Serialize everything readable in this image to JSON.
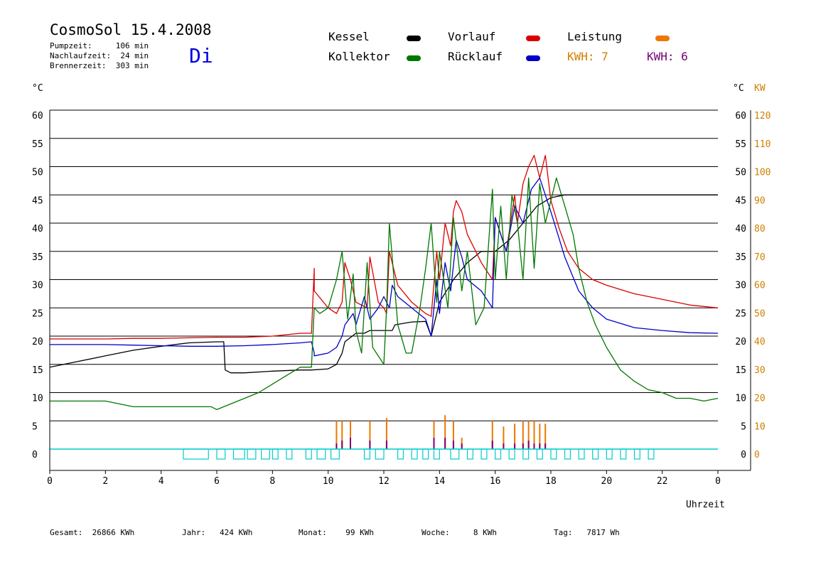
{
  "header": {
    "title": "CosmoSol 15.4.2008",
    "weekday": "Di",
    "pumpzeit": "Pumpzeit:     106 min",
    "nachlaufzeit": "Nachlaufzeit:  24 min",
    "brennerzeit": "Brennerzeit:  303 min"
  },
  "legend": {
    "kessel": "Kessel",
    "kollektor": "Kollektor",
    "vorlauf": "Vorlauf",
    "ruecklauf": "Rücklauf",
    "leistung": "Leistung",
    "kwh_orange": "KWH: 7",
    "kwh_purple": "KWH: 6"
  },
  "footer": {
    "gesamt": "Gesamt:  26866 KWh",
    "jahr": "Jahr:   424 KWh",
    "monat": "Monat:    99 KWh",
    "woche": "Woche:     8 KWh",
    "tag": "Tag:   7817 Wh"
  },
  "colors": {
    "kessel": "#000000",
    "kollektor": "#007700",
    "vorlauf": "#dd0000",
    "ruecklauf": "#0000cc",
    "leistung": "#ee7700",
    "kwh_purple": "#770077",
    "pump": "#00cccc",
    "axis_right_kw": "#d08000"
  },
  "chart_data": {
    "type": "line",
    "xlabel": "Uhrzeit",
    "ylabel_left": "°C",
    "ylabel_right": "°C",
    "ylabel_right2": "KW",
    "xlim": [
      0,
      24
    ],
    "ylim": [
      0,
      60
    ],
    "y2lim": [
      0,
      120
    ],
    "x_ticks": [
      "0",
      "2",
      "4",
      "6",
      "8",
      "10",
      "12",
      "14",
      "16",
      "18",
      "20",
      "22",
      "0"
    ],
    "y_ticks": [
      "0",
      "5",
      "10",
      "15",
      "20",
      "25",
      "30",
      "35",
      "40",
      "45",
      "50",
      "55",
      "60"
    ],
    "y2_ticks": [
      "0",
      "10",
      "20",
      "30",
      "40",
      "50",
      "60",
      "70",
      "80",
      "90",
      "100",
      "110",
      "120"
    ],
    "grid": true,
    "series": [
      {
        "name": "Kessel",
        "key": "kessel",
        "x": [
          0,
          1,
          2,
          3,
          4,
          5,
          6,
          6.25,
          6.3,
          6.5,
          7,
          8,
          9,
          9.4,
          10,
          10.3,
          10.5,
          10.6,
          11,
          11.3,
          11.5,
          12,
          12.3,
          12.4,
          13,
          13.5,
          13.7,
          14,
          14.5,
          15,
          15.5,
          16,
          16.5,
          17,
          17.5,
          18,
          18.5,
          20,
          22,
          24
        ],
        "y": [
          14.5,
          15.5,
          16.5,
          17.5,
          18.2,
          18.8,
          19,
          19,
          14,
          13.5,
          13.5,
          13.8,
          14,
          14,
          14.2,
          15,
          17,
          19,
          20.5,
          20.5,
          21,
          21,
          21,
          22,
          22.5,
          22.6,
          20,
          26,
          30,
          33,
          35,
          35,
          37,
          40,
          43,
          44.5,
          45,
          45,
          45,
          45
        ]
      },
      {
        "name": "Vorlauf",
        "key": "vorlauf",
        "x": [
          0,
          1,
          2,
          3,
          4,
          5,
          6,
          7,
          8,
          9,
          9.4,
          9.5,
          9.5,
          10,
          10.3,
          10.5,
          10.6,
          10.8,
          11,
          11.4,
          11.5,
          11.8,
          12,
          12.1,
          12.2,
          12.5,
          13,
          13.5,
          13.7,
          13.9,
          14,
          14.2,
          14.4,
          14.5,
          14.6,
          14.8,
          15,
          15.5,
          15.9,
          16,
          16.4,
          16.7,
          16.8,
          17,
          17.2,
          17.4,
          17.6,
          17.8,
          18,
          18.3,
          18.6,
          19,
          19.5,
          20,
          21,
          22,
          23,
          24
        ],
        "y": [
          19.5,
          19.5,
          19.5,
          19.6,
          19.6,
          19.7,
          19.8,
          19.8,
          20,
          20.5,
          20.5,
          32,
          28,
          25,
          24,
          26,
          33,
          30,
          26,
          25,
          34,
          26,
          25,
          24,
          35,
          29,
          26,
          24,
          23.5,
          35,
          30,
          40,
          36,
          42,
          44,
          42,
          38,
          33,
          30,
          41,
          35,
          45,
          40,
          47,
          50,
          52,
          48,
          52,
          44,
          39,
          35,
          32,
          30,
          29,
          27.5,
          26.5,
          25.5,
          25
        ]
      },
      {
        "name": "Rücklauf",
        "key": "ruecklauf",
        "x": [
          0,
          1,
          2,
          3,
          4,
          5,
          6,
          7,
          8,
          9,
          9.4,
          9.5,
          9.5,
          10,
          10.3,
          10.5,
          10.6,
          10.9,
          11,
          11.3,
          11.5,
          11.8,
          12,
          12.2,
          12.3,
          12.5,
          13,
          13.5,
          13.7,
          13.9,
          14,
          14.2,
          14.4,
          14.6,
          14.8,
          15,
          15.5,
          15.9,
          16,
          16.4,
          16.7,
          17,
          17.3,
          17.6,
          17.8,
          18,
          18.5,
          19,
          19.5,
          20,
          21,
          22,
          23,
          24
        ],
        "y": [
          18.5,
          18.5,
          18.5,
          18.4,
          18.3,
          18.2,
          18.2,
          18.3,
          18.5,
          18.8,
          19,
          17,
          16.5,
          17,
          18,
          20,
          22,
          24,
          22,
          27,
          23,
          25,
          27,
          25,
          29,
          27,
          25,
          23,
          20,
          30,
          24,
          33,
          28,
          37,
          34,
          30,
          28,
          25,
          41,
          35,
          43,
          40,
          46,
          48,
          45,
          42,
          34,
          28,
          25,
          23,
          21.5,
          21,
          20.6,
          20.5
        ]
      },
      {
        "name": "Kollektor",
        "key": "kollektor",
        "x": [
          0,
          0.5,
          1,
          2,
          3,
          4,
          5,
          5.8,
          6,
          6.5,
          7,
          7.5,
          8,
          8.5,
          9,
          9.4,
          9.5,
          9.7,
          10,
          10.3,
          10.5,
          10.7,
          10.9,
          11,
          11.2,
          11.4,
          11.6,
          12,
          12.1,
          12.2,
          12.5,
          12.8,
          13,
          13.3,
          13.5,
          13.7,
          13.9,
          14,
          14.3,
          14.5,
          14.8,
          15,
          15.3,
          15.6,
          15.9,
          16,
          16.2,
          16.4,
          16.6,
          16.8,
          17,
          17.2,
          17.4,
          17.6,
          17.8,
          18,
          18.2,
          18.5,
          18.8,
          19,
          19.3,
          19.6,
          20,
          20.5,
          21,
          21.5,
          22,
          22.5,
          23,
          23.5,
          24
        ],
        "y": [
          8.5,
          8.5,
          8.5,
          8.5,
          7.5,
          7.5,
          7.5,
          7.5,
          7,
          8,
          9,
          10,
          11.5,
          13,
          14.5,
          14.5,
          25,
          24,
          25,
          30,
          35,
          23,
          31,
          21,
          17,
          33,
          18,
          15,
          25,
          40,
          22,
          17,
          17,
          25,
          32,
          40,
          26,
          35,
          25,
          41,
          28,
          35,
          22,
          25,
          46,
          30,
          43,
          30,
          45,
          40,
          30,
          48,
          32,
          47,
          40,
          44,
          48,
          43,
          38,
          32,
          26,
          22,
          18,
          14,
          12,
          10.5,
          10,
          9,
          9,
          8.5,
          9
        ]
      },
      {
        "name": "Leistung",
        "key": "leistung",
        "x": [
          10.3,
          10.5,
          10.8,
          11.5,
          12.1,
          13.8,
          14.2,
          14.5,
          14.8,
          15.9,
          16.3,
          16.7,
          17,
          17.2,
          17.4,
          17.6,
          17.8
        ],
        "y": [
          5,
          5,
          5,
          5,
          5.5,
          5,
          6,
          5,
          2,
          5,
          4,
          4.5,
          5,
          5,
          5,
          4.5,
          4.5
        ]
      },
      {
        "name": "KWH",
        "key": "kwh_purple",
        "x": [
          10.3,
          10.5,
          10.8,
          11.5,
          12.1,
          13.8,
          14.2,
          14.5,
          14.8,
          15.9,
          16.3,
          16.7,
          17,
          17.2,
          17.4,
          17.6,
          17.8
        ],
        "y": [
          1,
          1.5,
          2,
          1.5,
          1.5,
          2,
          2,
          1.5,
          1,
          1.5,
          1,
          1,
          1,
          1.5,
          1,
          1,
          1
        ]
      }
    ],
    "pump_intervals": [
      [
        4.8,
        5.7
      ],
      [
        6.0,
        6.3
      ],
      [
        6.6,
        7.0
      ],
      [
        7.1,
        7.4
      ],
      [
        7.6,
        7.9
      ],
      [
        8.0,
        8.2
      ],
      [
        8.5,
        8.7
      ],
      [
        9.2,
        9.4
      ],
      [
        9.6,
        9.9
      ],
      [
        10.1,
        10.4
      ],
      [
        11.3,
        11.5
      ],
      [
        11.7,
        12.0
      ],
      [
        12.5,
        12.7
      ],
      [
        13.0,
        13.2
      ],
      [
        13.4,
        13.6
      ],
      [
        13.8,
        14.0
      ],
      [
        14.4,
        14.7
      ],
      [
        15.0,
        15.2
      ],
      [
        15.5,
        15.7
      ],
      [
        16.0,
        16.2
      ],
      [
        16.5,
        16.7
      ],
      [
        17.0,
        17.2
      ],
      [
        17.5,
        17.7
      ],
      [
        18.0,
        18.2
      ],
      [
        18.5,
        18.7
      ],
      [
        19.0,
        19.2
      ],
      [
        19.5,
        19.7
      ],
      [
        20.0,
        20.2
      ],
      [
        20.5,
        20.7
      ],
      [
        21.0,
        21.2
      ],
      [
        21.5,
        21.7
      ]
    ]
  }
}
